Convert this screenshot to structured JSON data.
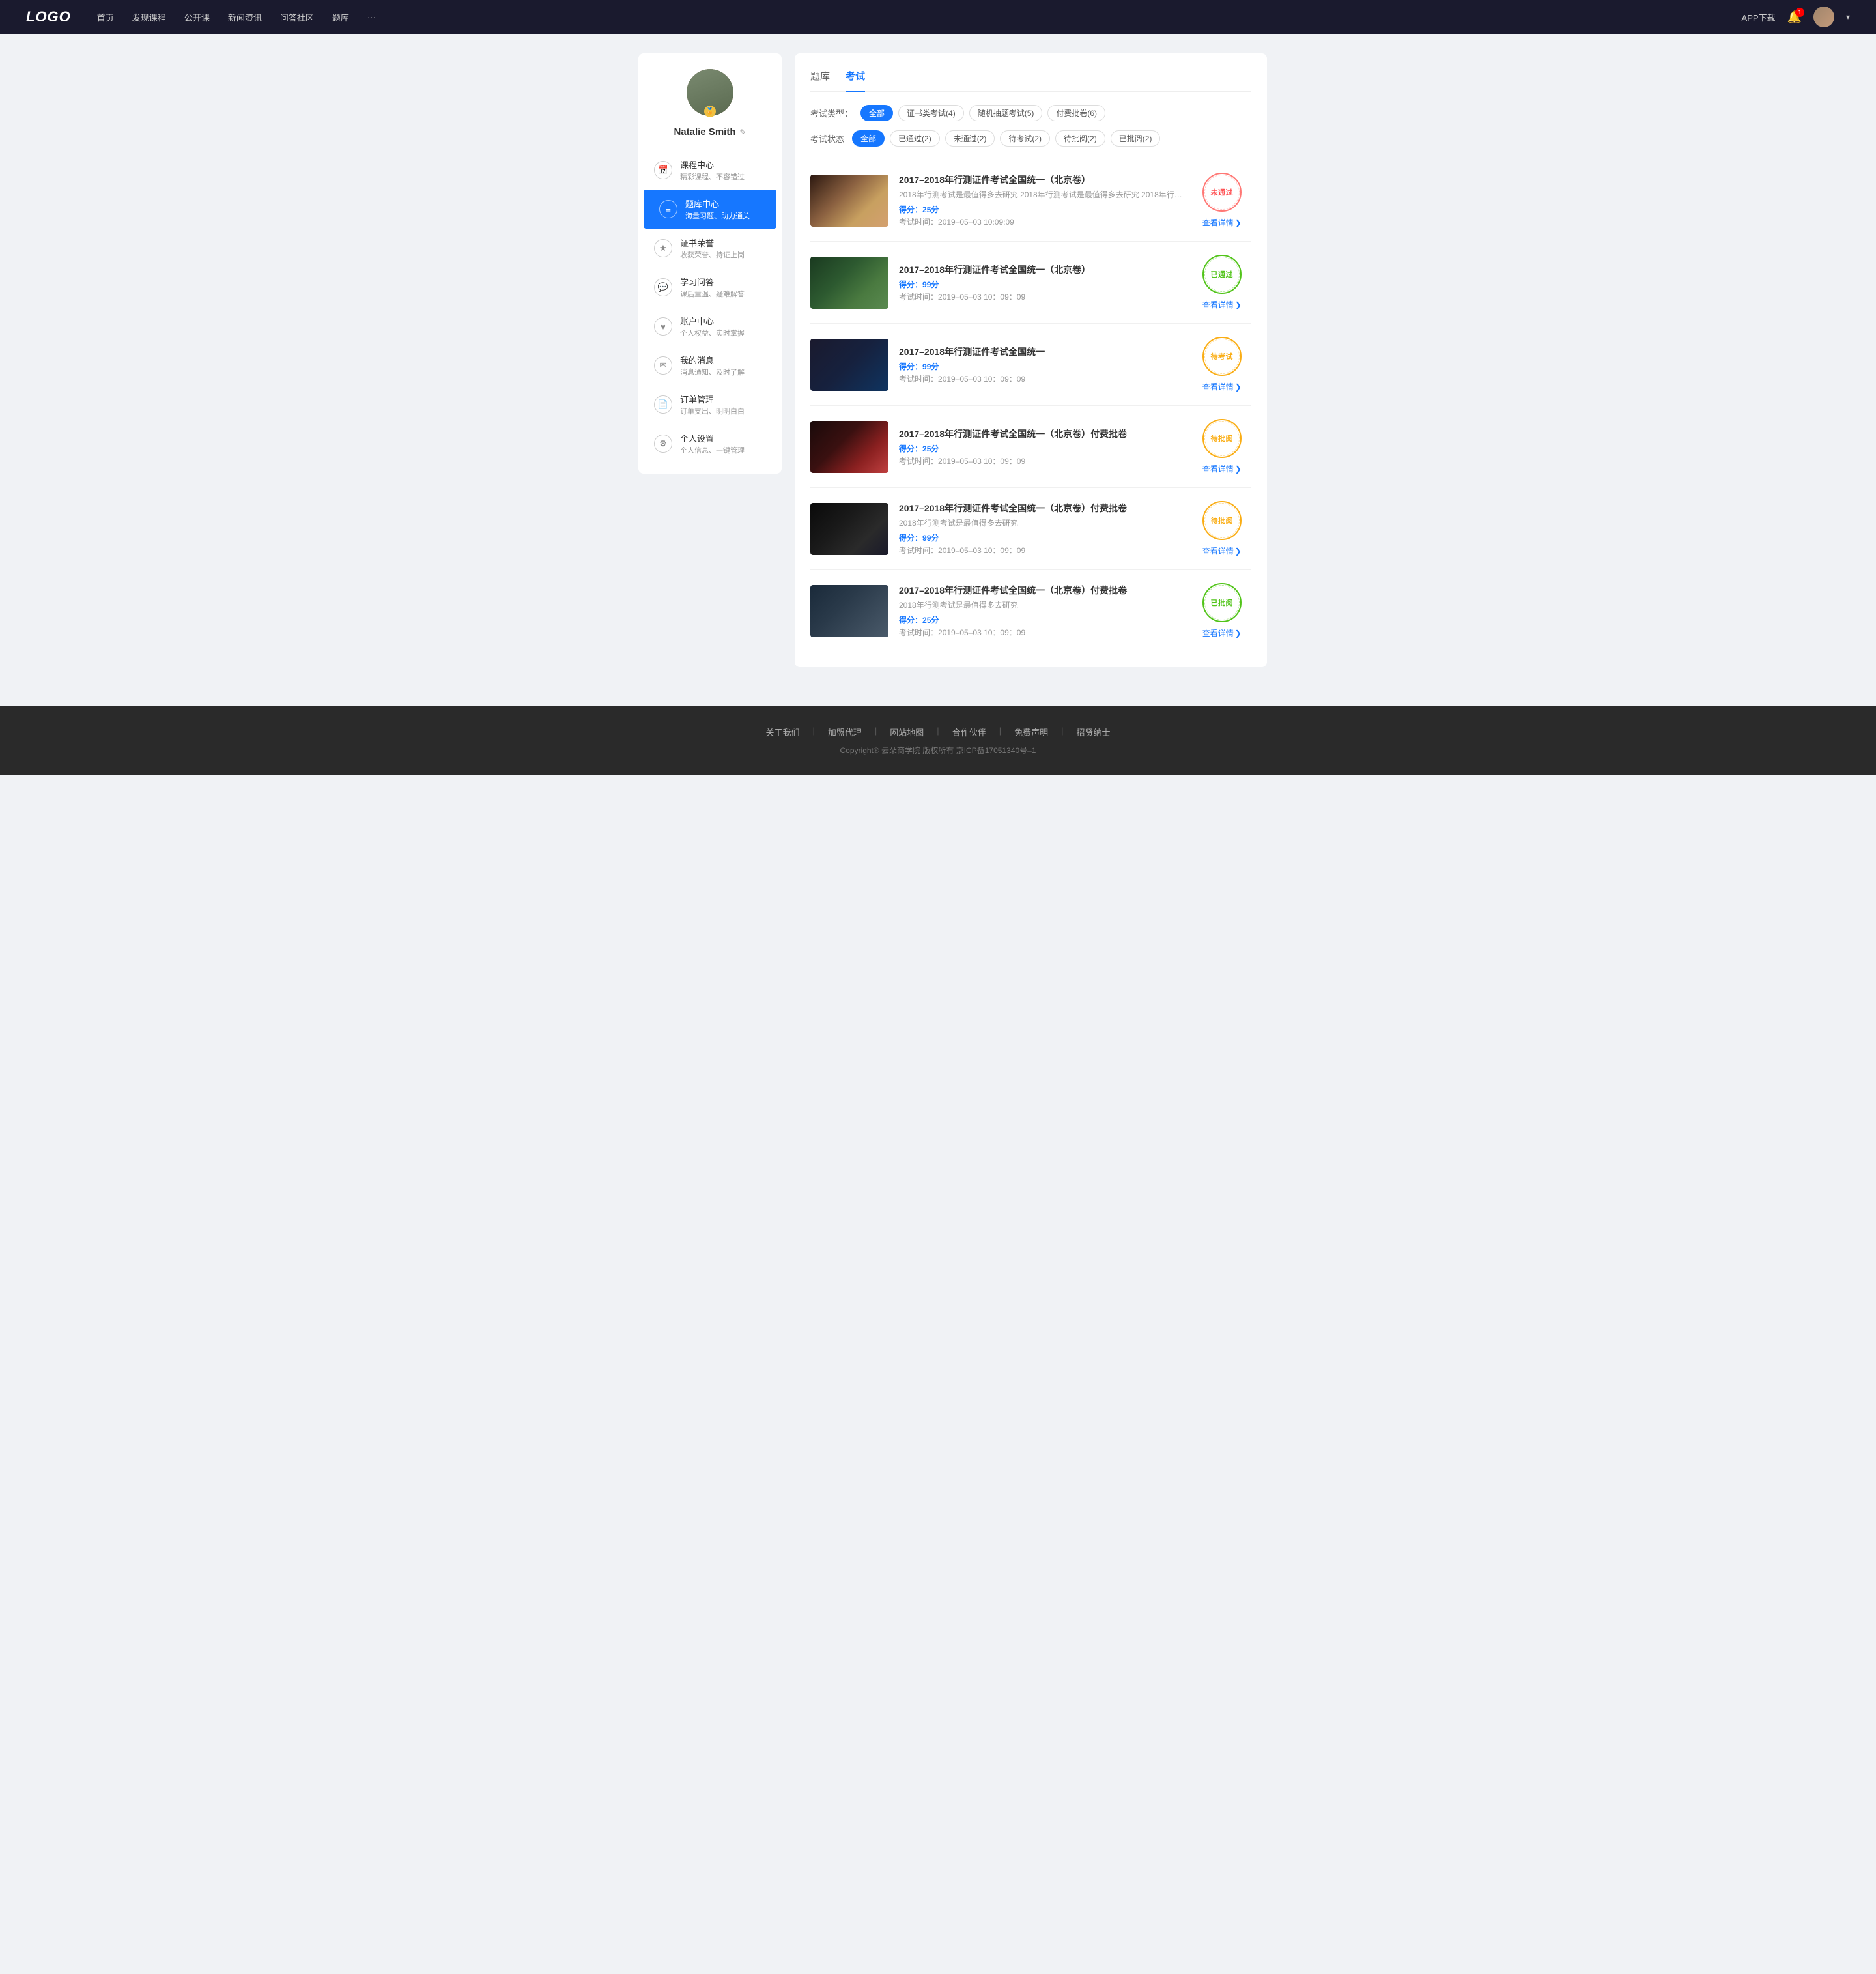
{
  "navbar": {
    "logo": "LOGO",
    "nav_items": [
      "首页",
      "发现课程",
      "公开课",
      "新闻资讯",
      "问答社区",
      "题库",
      "···"
    ],
    "app_download": "APP下载",
    "bell_badge": "1",
    "chevron": "▾"
  },
  "sidebar": {
    "username": "Natalie Smith",
    "edit_icon": "✎",
    "badge_icon": "🏅",
    "menu": [
      {
        "id": "course",
        "icon": "📅",
        "title": "课程中心",
        "sub": "精彩课程、不容错过",
        "active": false
      },
      {
        "id": "question",
        "icon": "≡",
        "title": "题库中心",
        "sub": "海量习题、助力通关",
        "active": true
      },
      {
        "id": "certificate",
        "icon": "★",
        "title": "证书荣誉",
        "sub": "收获荣誉、持证上岗",
        "active": false
      },
      {
        "id": "study",
        "icon": "💬",
        "title": "学习问答",
        "sub": "课后重温、疑难解答",
        "active": false
      },
      {
        "id": "account",
        "icon": "♥",
        "title": "账户中心",
        "sub": "个人权益、实时掌握",
        "active": false
      },
      {
        "id": "message",
        "icon": "💬",
        "title": "我的消息",
        "sub": "消息通知、及时了解",
        "active": false
      },
      {
        "id": "order",
        "icon": "📄",
        "title": "订单管理",
        "sub": "订单支出、明明白白",
        "active": false
      },
      {
        "id": "setting",
        "icon": "⚙",
        "title": "个人设置",
        "sub": "个人信息、一键管理",
        "active": false
      }
    ]
  },
  "content": {
    "tabs": [
      {
        "id": "question-bank",
        "label": "题库",
        "active": false
      },
      {
        "id": "exam",
        "label": "考试",
        "active": true
      }
    ],
    "filter_type": {
      "label": "考试类型：",
      "tags": [
        {
          "label": "全部",
          "active": true
        },
        {
          "label": "证书类考试(4)",
          "active": false
        },
        {
          "label": "随机抽题考试(5)",
          "active": false
        },
        {
          "label": "付费批卷(6)",
          "active": false
        }
      ]
    },
    "filter_status": {
      "label": "考试状态",
      "tags": [
        {
          "label": "全部",
          "active": true
        },
        {
          "label": "已通过(2)",
          "active": false
        },
        {
          "label": "未通过(2)",
          "active": false
        },
        {
          "label": "待考试(2)",
          "active": false
        },
        {
          "label": "待批阅(2)",
          "active": false
        },
        {
          "label": "已批阅(2)",
          "active": false
        }
      ]
    },
    "exams": [
      {
        "id": "exam1",
        "title": "2017–2018年行测证件考试全国统一（北京卷）",
        "desc": "2018年行测考试是最值得多去研究 2018年行测考试是最值得多去研究 2018年行…",
        "score_label": "得分：",
        "score": "25",
        "score_unit": "分",
        "time_label": "考试时间：",
        "time": "2019–05–03  10:09:09",
        "status_text": "未通过",
        "status_class": "stamp-untested",
        "thumb_class": "thumb-1",
        "view_label": "查看详情"
      },
      {
        "id": "exam2",
        "title": "2017–2018年行测证件考试全国统一（北京卷）",
        "desc": "",
        "score_label": "得分：",
        "score": "99",
        "score_unit": "分",
        "time_label": "考试时间：",
        "time": "2019–05–03  10：09：09",
        "status_text": "已通过",
        "status_class": "stamp-passed",
        "thumb_class": "thumb-2",
        "view_label": "查看详情"
      },
      {
        "id": "exam3",
        "title": "2017–2018年行测证件考试全国统一",
        "desc": "",
        "score_label": "得分：",
        "score": "99",
        "score_unit": "分",
        "time_label": "考试时间：",
        "time": "2019–05–03  10：09：09",
        "status_text": "待考试",
        "status_class": "stamp-pending",
        "thumb_class": "thumb-3",
        "view_label": "查看详情"
      },
      {
        "id": "exam4",
        "title": "2017–2018年行测证件考试全国统一（北京卷）付费批卷",
        "desc": "",
        "score_label": "得分：",
        "score": "25",
        "score_unit": "分",
        "time_label": "考试时间：",
        "time": "2019–05–03  10：09：09",
        "status_text": "待批阅",
        "status_class": "stamp-pending-review",
        "thumb_class": "thumb-4",
        "view_label": "查看详情"
      },
      {
        "id": "exam5",
        "title": "2017–2018年行测证件考试全国统一（北京卷）付费批卷",
        "desc": "2018年行测考试是最值得多去研究",
        "score_label": "得分：",
        "score": "99",
        "score_unit": "分",
        "time_label": "考试时间：",
        "time": "2019–05–03  10：09：09",
        "status_text": "待批阅",
        "status_class": "stamp-pending-review",
        "thumb_class": "thumb-5",
        "view_label": "查看详情"
      },
      {
        "id": "exam6",
        "title": "2017–2018年行测证件考试全国统一（北京卷）付费批卷",
        "desc": "2018年行测考试是最值得多去研究",
        "score_label": "得分：",
        "score": "25",
        "score_unit": "分",
        "time_label": "考试时间：",
        "time": "2019–05–03  10：09：09",
        "status_text": "已批阅",
        "status_class": "stamp-reviewed",
        "thumb_class": "thumb-6",
        "view_label": "查看详情"
      }
    ]
  },
  "footer": {
    "links": [
      "关于我们",
      "加盟代理",
      "网站地图",
      "合作伙伴",
      "免费声明",
      "招贤纳士"
    ],
    "copyright": "Copyright® 云朵商学院  版权所有    京ICP备17051340号–1"
  }
}
